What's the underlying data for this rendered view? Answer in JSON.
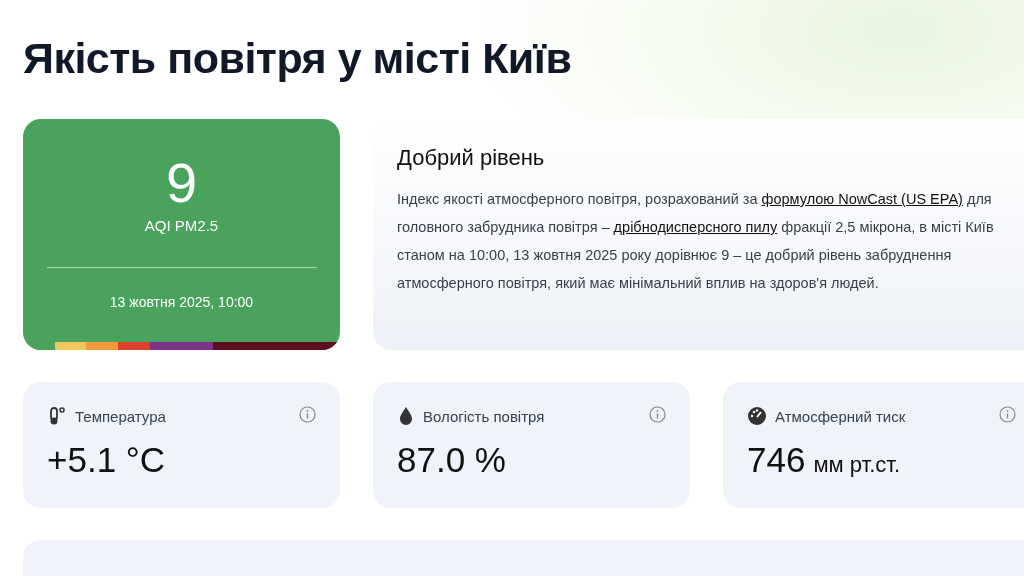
{
  "title": "Якість повітря у місті Київ",
  "aqi": {
    "value": "9",
    "label": "AQI PM2.5",
    "datetime": "13 жовтня 2025, 10:00",
    "color": "#4aa35d",
    "scale": [
      {
        "color": "#4aa35d"
      },
      {
        "color": "#f1c75a"
      },
      {
        "color": "#f09a3a"
      },
      {
        "color": "#d9432b"
      },
      {
        "color": "#7b3289"
      },
      {
        "color": "#5e0f1f"
      }
    ]
  },
  "description": {
    "heading": "Добрий рівень",
    "parts": [
      {
        "kind": "text",
        "text": "Індекс якості атмосферного повітря, розрахований за "
      },
      {
        "kind": "link",
        "text": "формулою NowCast (US EPA)"
      },
      {
        "kind": "text",
        "text": " для головного забрудника повітря – "
      },
      {
        "kind": "link",
        "text": "дрібнодисперсного пилу"
      },
      {
        "kind": "text",
        "text": " фракції 2,5 мікрона, в місті Київ станом на 10:00, 13 жовтня 2025 року дорівнює 9 – це добрий рівень забруднення атмосферного повітря, який має мінімальний вплив на здоров'я людей."
      }
    ]
  },
  "metrics": [
    {
      "kind": "temperature",
      "label": "Температура",
      "value": "+5.1 °C"
    },
    {
      "kind": "humidity",
      "label": "Вологість повітря",
      "value": "87.0 %"
    },
    {
      "kind": "pressure",
      "label": "Атмосферний тиск",
      "value": "746",
      "unit": "мм рт.ст."
    }
  ]
}
